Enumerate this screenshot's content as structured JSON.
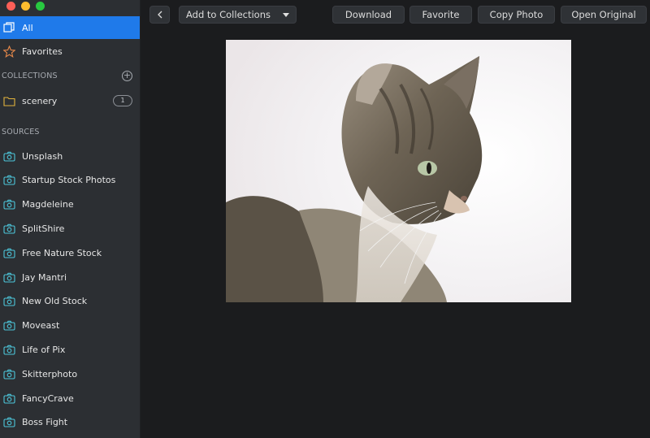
{
  "sidebar": {
    "all": "All",
    "favorites": "Favorites",
    "collections_header": "COLLECTIONS",
    "collections": [
      {
        "label": "scenery",
        "count": "1"
      }
    ],
    "sources_header": "SOURCES",
    "sources": [
      "Unsplash",
      "Startup Stock Photos",
      "Magdeleine",
      "SplitShire",
      "Free Nature Stock",
      "Jay Mantri",
      "New Old Stock",
      "Moveast",
      "Life of Pix",
      "Skitterphoto",
      "FancyCrave",
      "Boss Fight"
    ]
  },
  "toolbar": {
    "add_to_collections": "Add to Collections",
    "download": "Download",
    "favorite": "Favorite",
    "copy_photo": "Copy Photo",
    "open_original": "Open Original"
  },
  "colors": {
    "accent": "#1f7aea",
    "sidebar_bg": "#2c2f33",
    "main_bg": "#1b1c1e",
    "source_icon": "#4cc5d9",
    "favorites_icon": "#e8894a",
    "folder_icon": "#e2b33c"
  }
}
